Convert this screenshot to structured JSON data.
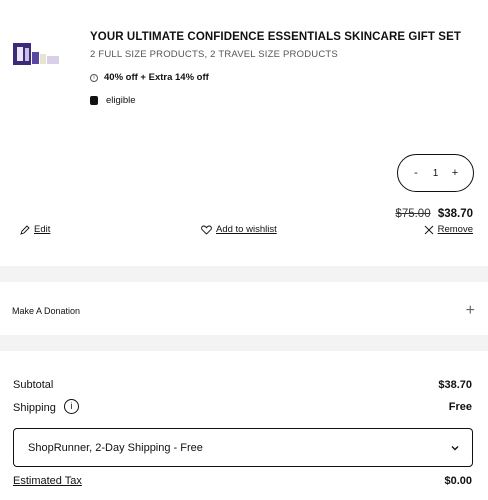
{
  "product": {
    "title": "YOUR ULTIMATE CONFIDENCE ESSENTIALS SKINCARE GIFT SET",
    "subtitle": "2 FULL SIZE PRODUCTS, 2 TRAVEL SIZE PRODUCTS",
    "promo": "40% off + Extra 14% off",
    "eligible": "eligible",
    "quantity": "1",
    "decrement": "-",
    "increment": "+",
    "original_price": "$75.00",
    "sale_price": "$38.70"
  },
  "actions": {
    "edit": "Edit",
    "wishlist": "Add to wishlist",
    "remove": "Remove"
  },
  "donation": {
    "label": "Make A Donation",
    "expand": "+"
  },
  "summary": {
    "subtotal_label": "Subtotal",
    "subtotal_value": "$38.70",
    "shipping_label": "Shipping",
    "shipping_info": "i",
    "shipping_value": "Free",
    "shipping_option": "ShopRunner, 2-Day Shipping - Free",
    "tax_label": "Estimated Tax",
    "tax_value": "$0.00"
  }
}
